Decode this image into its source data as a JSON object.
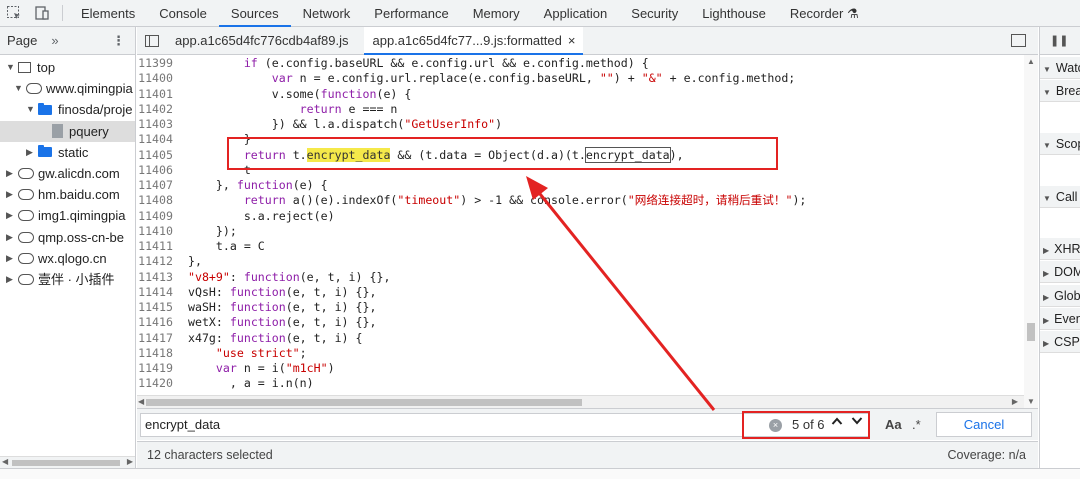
{
  "topbar": {
    "tabs": [
      "Elements",
      "Console",
      "Sources",
      "Network",
      "Performance",
      "Memory",
      "Application",
      "Security",
      "Lighthouse",
      "Recorder ⚗"
    ],
    "active_tab": "Sources"
  },
  "navigator": {
    "tab_label": "Page",
    "more_label": "»",
    "tree": [
      {
        "label": "top",
        "depth": 0,
        "icon": "frame-icon",
        "arrow": "▼"
      },
      {
        "label": "www.qimingpia",
        "depth": 1,
        "icon": "cloud-icon",
        "arrow": "▼"
      },
      {
        "label": "finosda/proje",
        "depth": 2,
        "icon": "folder-icon",
        "arrow": "▼"
      },
      {
        "label": "pquery",
        "depth": 3,
        "icon": "file-icon",
        "arrow": "",
        "selected": true
      },
      {
        "label": "static",
        "depth": 2,
        "icon": "folder-icon",
        "arrow": "▶"
      },
      {
        "label": "gw.alicdn.com",
        "depth": 0,
        "icon": "cloud-icon",
        "arrow": "▶"
      },
      {
        "label": "hm.baidu.com",
        "depth": 0,
        "icon": "cloud-icon",
        "arrow": "▶"
      },
      {
        "label": "img1.qimingpia",
        "depth": 0,
        "icon": "cloud-icon",
        "arrow": "▶"
      },
      {
        "label": "qmp.oss-cn-be",
        "depth": 0,
        "icon": "cloud-icon",
        "arrow": "▶"
      },
      {
        "label": "wx.qlogo.cn",
        "depth": 0,
        "icon": "cloud-icon",
        "arrow": "▶"
      },
      {
        "label": "壹伴 · 小插件",
        "depth": 0,
        "icon": "cloud-icon",
        "arrow": "▶"
      }
    ]
  },
  "editor": {
    "file_tabs": [
      {
        "label": "app.a1c65d4fc776cdb4af89.js",
        "active": false
      },
      {
        "label": "app.a1c65d4fc77...9.js:formatted",
        "active": true,
        "close": "×"
      }
    ],
    "lines": [
      {
        "n": "11399",
        "indent": 8,
        "parts": [
          [
            "kw",
            "if"
          ],
          [
            "src",
            " (e.config.baseURL && e.config.url && e.config.method) {"
          ]
        ]
      },
      {
        "n": "11400",
        "indent": 12,
        "parts": [
          [
            "kw",
            "var"
          ],
          [
            "src",
            " n = e.config.url.replace(e.config.baseURL, "
          ],
          [
            "st",
            "\"\""
          ],
          [
            "src",
            ") + "
          ],
          [
            "st",
            "\"&\""
          ],
          [
            "src",
            " + e.config.method;"
          ]
        ]
      },
      {
        "n": "11401",
        "indent": 12,
        "parts": [
          [
            "src",
            "v.some("
          ],
          [
            "kw",
            "function"
          ],
          [
            "src",
            "(e) {"
          ]
        ]
      },
      {
        "n": "11402",
        "indent": 16,
        "parts": [
          [
            "kw",
            "return"
          ],
          [
            "src",
            " e === n"
          ]
        ]
      },
      {
        "n": "11403",
        "indent": 12,
        "parts": [
          [
            "src",
            "}) && l.a.dispatch("
          ],
          [
            "st",
            "\"GetUserInfo\""
          ],
          [
            "src",
            ")"
          ]
        ]
      },
      {
        "n": "11404",
        "indent": 8,
        "parts": [
          [
            "src",
            "}"
          ]
        ]
      },
      {
        "n": "11405",
        "indent": 8,
        "parts": [
          [
            "kw",
            "return"
          ],
          [
            "src",
            " t."
          ],
          [
            "hl",
            "encrypt_data"
          ],
          [
            "src",
            " && (t.data = Object(d.a)(t."
          ],
          [
            "hlb",
            "encrypt_data"
          ],
          [
            "src",
            "),"
          ]
        ]
      },
      {
        "n": "11406",
        "indent": 8,
        "parts": [
          [
            "src",
            "t"
          ]
        ]
      },
      {
        "n": "11407",
        "indent": 4,
        "parts": [
          [
            "src",
            "}, "
          ],
          [
            "kw",
            "function"
          ],
          [
            "src",
            "(e) {"
          ]
        ]
      },
      {
        "n": "11408",
        "indent": 8,
        "parts": [
          [
            "kw",
            "return"
          ],
          [
            "src",
            " a()(e).indexOf("
          ],
          [
            "st",
            "\"timeout\""
          ],
          [
            "src",
            ") > -1 && console.error("
          ],
          [
            "st",
            "\"网络连接超时，请稍后重试！\""
          ],
          [
            "src",
            ");"
          ]
        ]
      },
      {
        "n": "11409",
        "indent": 8,
        "parts": [
          [
            "src",
            "s.a.reject(e)"
          ]
        ]
      },
      {
        "n": "11410",
        "indent": 4,
        "parts": [
          [
            "src",
            "});"
          ]
        ]
      },
      {
        "n": "11411",
        "indent": 4,
        "parts": [
          [
            "src",
            "t.a = C"
          ]
        ]
      },
      {
        "n": "11412",
        "indent": 0,
        "parts": [
          [
            "src",
            "},"
          ]
        ]
      },
      {
        "n": "11413",
        "indent": 0,
        "parts": [
          [
            "st",
            "\"v8+9\""
          ],
          [
            "src",
            ": "
          ],
          [
            "kw",
            "function"
          ],
          [
            "src",
            "(e, t, i) {},"
          ]
        ]
      },
      {
        "n": "11414",
        "indent": 0,
        "parts": [
          [
            "src",
            "vQsH: "
          ],
          [
            "kw",
            "function"
          ],
          [
            "src",
            "(e, t, i) {},"
          ]
        ]
      },
      {
        "n": "11415",
        "indent": 0,
        "parts": [
          [
            "src",
            "waSH: "
          ],
          [
            "kw",
            "function"
          ],
          [
            "src",
            "(e, t, i) {},"
          ]
        ]
      },
      {
        "n": "11416",
        "indent": 0,
        "parts": [
          [
            "src",
            "wetX: "
          ],
          [
            "kw",
            "function"
          ],
          [
            "src",
            "(e, t, i) {},"
          ]
        ]
      },
      {
        "n": "11417",
        "indent": 0,
        "parts": [
          [
            "src",
            "x47g: "
          ],
          [
            "kw",
            "function"
          ],
          [
            "src",
            "(e, t, i) {"
          ]
        ]
      },
      {
        "n": "11418",
        "indent": 4,
        "parts": [
          [
            "st",
            "\"use strict\""
          ],
          [
            "src",
            ";"
          ]
        ]
      },
      {
        "n": "11419",
        "indent": 4,
        "parts": [
          [
            "kw",
            "var"
          ],
          [
            "src",
            " n = i("
          ],
          [
            "st",
            "\"m1cH\""
          ],
          [
            "src",
            ")"
          ]
        ]
      },
      {
        "n": "11420",
        "indent": 6,
        "parts": [
          [
            "src",
            ", a = i.n(n)"
          ]
        ]
      }
    ]
  },
  "search": {
    "query": "encrypt_data",
    "match_count": "5 of 6",
    "clear": "×",
    "prev": "⌃",
    "next": "⌄",
    "case_label": "Aa",
    "regex_label": ".*",
    "cancel_label": "Cancel"
  },
  "status": {
    "selection": "12 characters selected",
    "coverage": "Coverage: n/a"
  },
  "debugger": {
    "sections": [
      {
        "label": "Watch",
        "arrow": "▼"
      },
      {
        "label": "Breakpoints",
        "arrow": "▼"
      },
      {
        "label": "Scope",
        "arrow": "▼"
      },
      {
        "label": "Call Stack",
        "arrow": "▼"
      },
      {
        "label": "XHR/fetch Breakpoints",
        "arrow": "▶"
      },
      {
        "label": "DOM Breakpoints",
        "arrow": "▶"
      },
      {
        "label": "Global Listeners",
        "arrow": "▶"
      },
      {
        "label": "Event Listener Breakpoints",
        "arrow": "▶"
      },
      {
        "label": "CSP Violation Breakpoints",
        "arrow": "▶"
      }
    ]
  },
  "colors": {
    "annotation": "#e32322",
    "accent": "#1a73e8",
    "highlight": "#f5e94a"
  }
}
